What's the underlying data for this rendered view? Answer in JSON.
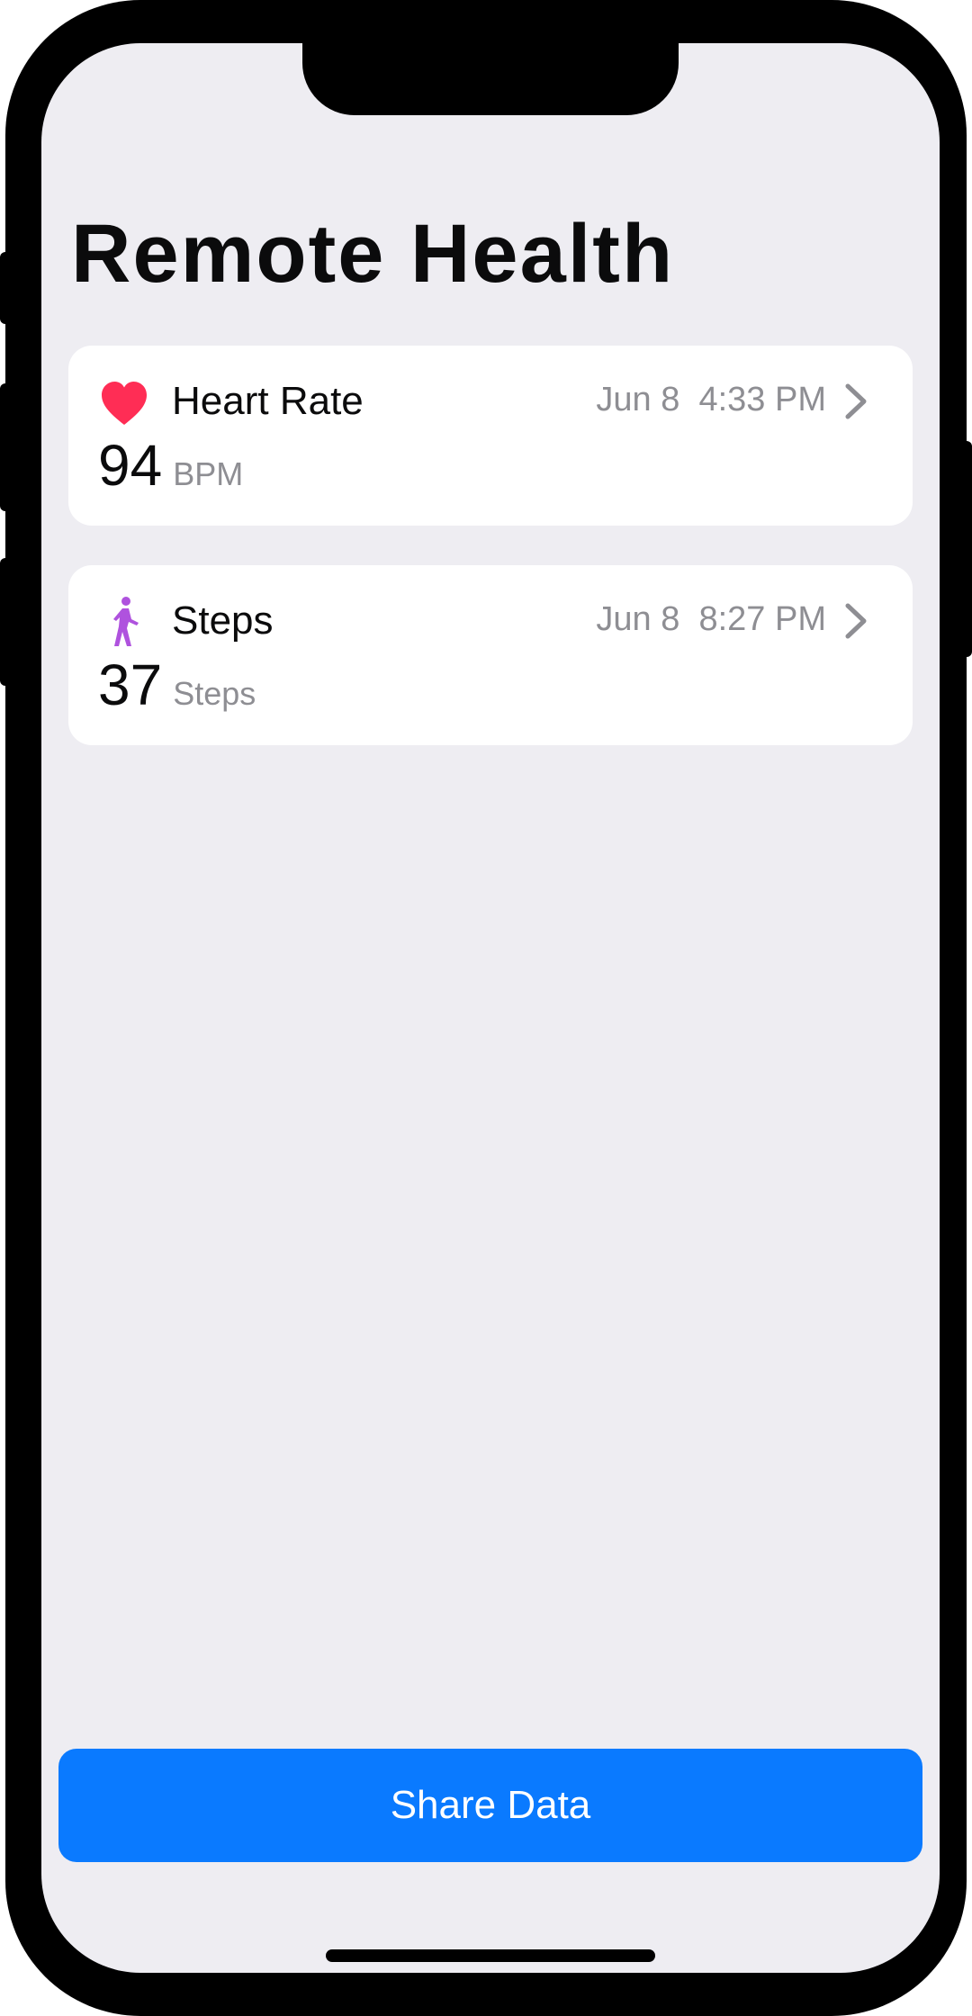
{
  "app": {
    "title": "Remote Health"
  },
  "cards": [
    {
      "icon": "heart-icon",
      "name": "Heart Rate",
      "date": "Jun 8  4:33 PM",
      "value": "94",
      "unit": "BPM"
    },
    {
      "icon": "walking-figure-icon",
      "name": "Steps",
      "date": "Jun 8  8:27 PM",
      "value": "37",
      "unit": "Steps"
    }
  ],
  "share_button": {
    "label": "Share Data"
  },
  "colors": {
    "accent": "#0A7AFF",
    "heart": "#FF2D55",
    "steps": "#AF52DE",
    "background": "#EEEDF2",
    "secondary_text": "#8E8E93"
  }
}
